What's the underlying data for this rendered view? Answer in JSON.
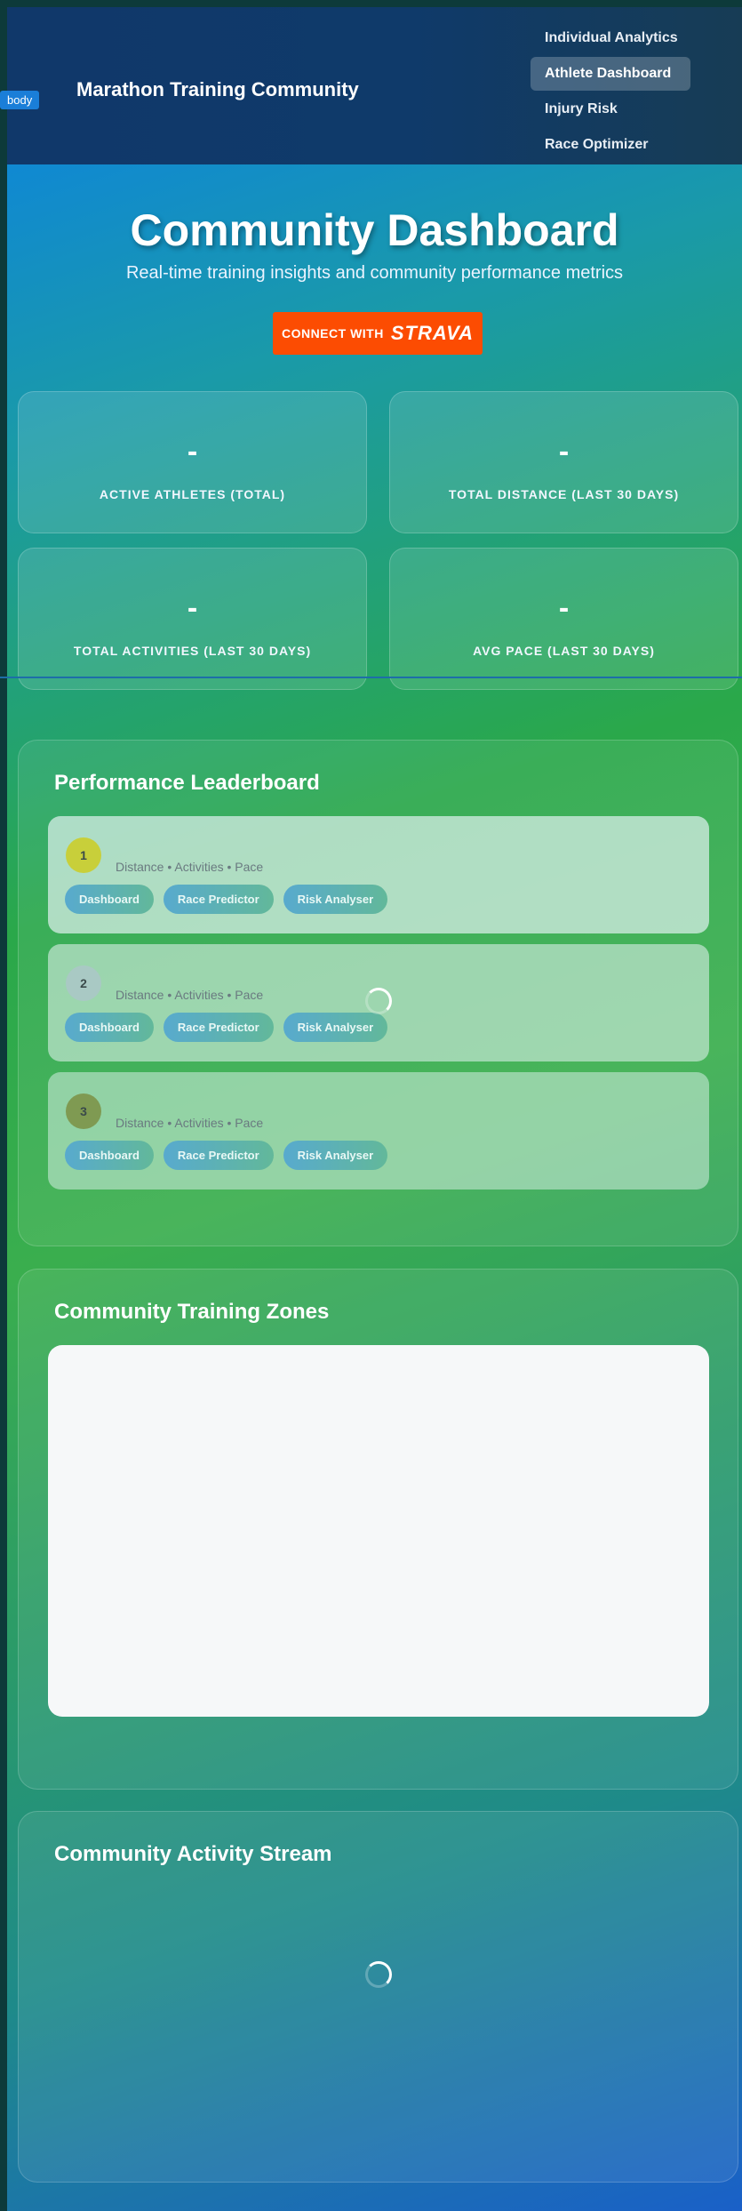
{
  "devtools_label": "body",
  "header": {
    "brand": "Marathon Training Community",
    "nav": [
      {
        "label": "Individual Analytics",
        "active": false
      },
      {
        "label": "Athlete Dashboard",
        "active": true
      },
      {
        "label": "Injury Risk",
        "active": false
      },
      {
        "label": "Race Optimizer",
        "active": false
      }
    ]
  },
  "hero": {
    "title": "Community Dashboard",
    "subtitle": "Real-time training insights and community performance metrics",
    "strava_prefix": "CONNECT WITH",
    "strava_brand": "STRAVA"
  },
  "stats": [
    {
      "value": "-",
      "label": "ACTIVE ATHLETES (TOTAL)"
    },
    {
      "value": "-",
      "label": "TOTAL DISTANCE (LAST 30 DAYS)"
    },
    {
      "value": "-",
      "label": "TOTAL ACTIVITIES (LAST 30 DAYS)"
    },
    {
      "value": "-",
      "label": "AVG PACE (LAST 30 DAYS)"
    }
  ],
  "leaderboard": {
    "title": "Performance Leaderboard",
    "entries": [
      {
        "rank": "1",
        "meta": "Distance • Activities • Pace",
        "rank_color": "#c8cf3a"
      },
      {
        "rank": "2",
        "meta": "Distance • Activities • Pace",
        "rank_color": "#a9c9c4"
      },
      {
        "rank": "3",
        "meta": "Distance • Activities • Pace",
        "rank_color": "#7f9a52"
      }
    ],
    "actions": [
      "Dashboard",
      "Race Predictor",
      "Risk Analyser"
    ]
  },
  "zones": {
    "title": "Community Training Zones"
  },
  "stream": {
    "title": "Community Activity Stream"
  },
  "colors": {
    "strava": "#fc4c02",
    "header_bg": "#10386a",
    "nav_active_bg": "rgba(255,255,255,0.22)"
  }
}
